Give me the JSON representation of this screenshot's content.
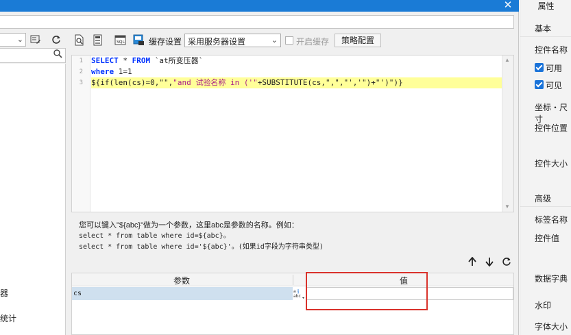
{
  "titlebar": {
    "close_glyph": "✕"
  },
  "left": {
    "items": [
      "器",
      "统计"
    ]
  },
  "toolbar": {
    "cache_label": "缓存设置",
    "cache_select_value": "采用服务器设置",
    "enable_cache_label": "开启缓存",
    "strategy_button": "策略配置"
  },
  "editor": {
    "line_numbers": [
      "1",
      "2",
      "3"
    ],
    "line1": {
      "kw1": "SELECT",
      "star": " * ",
      "kw2": "FROM",
      "rest": " `at所变压器`"
    },
    "line2": {
      "kw": "where",
      "rest": " 1=1"
    },
    "line3": {
      "a": "${if(len(cs)=0,\"\",",
      "b": "\"and 试验名称 in ('\"",
      "c": "+SUBSTITUTE(cs,\",\",\"','\")+\"')\")}"
    }
  },
  "help": {
    "line1": "您可以键入\"${abc}\"做为一个参数，这里abc是参数的名称。例如：",
    "line2": "select * from table where id=${abc}。",
    "line3": "select * from table where id='${abc}'。(如果id字段为字符串类型)"
  },
  "params": {
    "header_name": "参数",
    "header_value": "值",
    "rows": [
      {
        "name": "cs",
        "value": ""
      }
    ]
  },
  "right_panel": {
    "title": "属性",
    "basic": "基本",
    "widget_name": "控件名称",
    "enabled": "可用",
    "visible": "可见",
    "coord_size": "坐标・尺寸",
    "position": "控件位置",
    "size": "控件大小",
    "advanced": "高级",
    "label_name": "标签名称",
    "widget_value": "控件值",
    "dictionary": "数据字典",
    "watermark": "水印",
    "font_size": "字体大小"
  },
  "colors": {
    "accent": "#1a7bd6",
    "highlight": "#ffff99",
    "annotation": "#d9322b"
  }
}
